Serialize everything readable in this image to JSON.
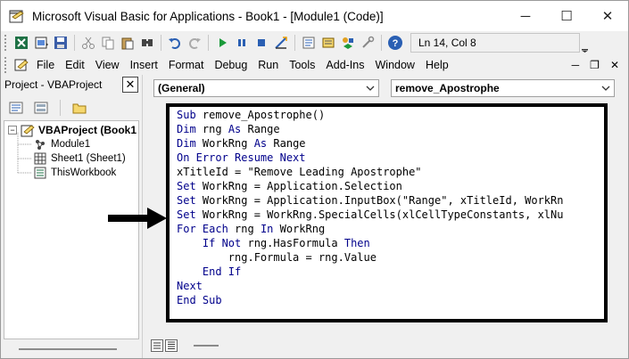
{
  "window": {
    "title": "Microsoft Visual Basic for Applications - Book1 - [Module1 (Code)]",
    "controls": {
      "minimize": "─",
      "maximize": "☐",
      "close": "✕"
    }
  },
  "toolbar": {
    "status": "Ln 14, Col 8"
  },
  "menu": {
    "items": [
      "File",
      "Edit",
      "View",
      "Insert",
      "Format",
      "Debug",
      "Run",
      "Tools",
      "Add-Ins",
      "Window",
      "Help"
    ],
    "doc_controls": {
      "minimize": "─",
      "restore": "❐",
      "close": "✕"
    }
  },
  "project_explorer": {
    "title": "Project - VBAProject",
    "close_label": "✕",
    "tree": {
      "root": "VBAProject (Book1",
      "children": [
        "Module1",
        "Sheet1 (Sheet1)",
        "ThisWorkbook"
      ]
    }
  },
  "code_window": {
    "object_combo": "(General)",
    "procedure_combo": "remove_Apostrophe",
    "lines": [
      [
        {
          "t": "Sub ",
          "c": "kw"
        },
        {
          "t": "remove_Apostrophe()",
          "c": "tx"
        }
      ],
      [
        {
          "t": "Dim ",
          "c": "kw"
        },
        {
          "t": "rng ",
          "c": "tx"
        },
        {
          "t": "As ",
          "c": "kw"
        },
        {
          "t": "Range",
          "c": "tx"
        }
      ],
      [
        {
          "t": "Dim ",
          "c": "kw"
        },
        {
          "t": "WorkRng ",
          "c": "tx"
        },
        {
          "t": "As ",
          "c": "kw"
        },
        {
          "t": "Range",
          "c": "tx"
        }
      ],
      [
        {
          "t": "On Error Resume Next",
          "c": "kw"
        }
      ],
      [
        {
          "t": "xTitleId = \"Remove Leading Apostrophe\"",
          "c": "tx"
        }
      ],
      [
        {
          "t": "Set ",
          "c": "kw"
        },
        {
          "t": "WorkRng = Application.Selection",
          "c": "tx"
        }
      ],
      [
        {
          "t": "Set ",
          "c": "kw"
        },
        {
          "t": "WorkRng = Application.InputBox(\"Range\", xTitleId, WorkRn",
          "c": "tx"
        }
      ],
      [
        {
          "t": "Set ",
          "c": "kw"
        },
        {
          "t": "WorkRng = WorkRng.SpecialCells(xlCellTypeConstants, xlNu",
          "c": "tx"
        }
      ],
      [
        {
          "t": "For Each ",
          "c": "kw"
        },
        {
          "t": "rng ",
          "c": "tx"
        },
        {
          "t": "In ",
          "c": "kw"
        },
        {
          "t": "WorkRng",
          "c": "tx"
        }
      ],
      [
        {
          "t": "    If Not ",
          "c": "kw"
        },
        {
          "t": "rng.HasFormula ",
          "c": "tx"
        },
        {
          "t": "Then",
          "c": "kw"
        }
      ],
      [
        {
          "t": "        rng.Formula = rng.Value",
          "c": "tx"
        }
      ],
      [
        {
          "t": "    End If",
          "c": "kw"
        }
      ],
      [
        {
          "t": "Next",
          "c": "kw"
        }
      ],
      [
        {
          "t": "End Sub",
          "c": "kw"
        }
      ]
    ]
  },
  "colors": {
    "keyword": "#00008b",
    "text": "#000000",
    "editor_border": "#000000",
    "background": "#f0f0f0"
  }
}
